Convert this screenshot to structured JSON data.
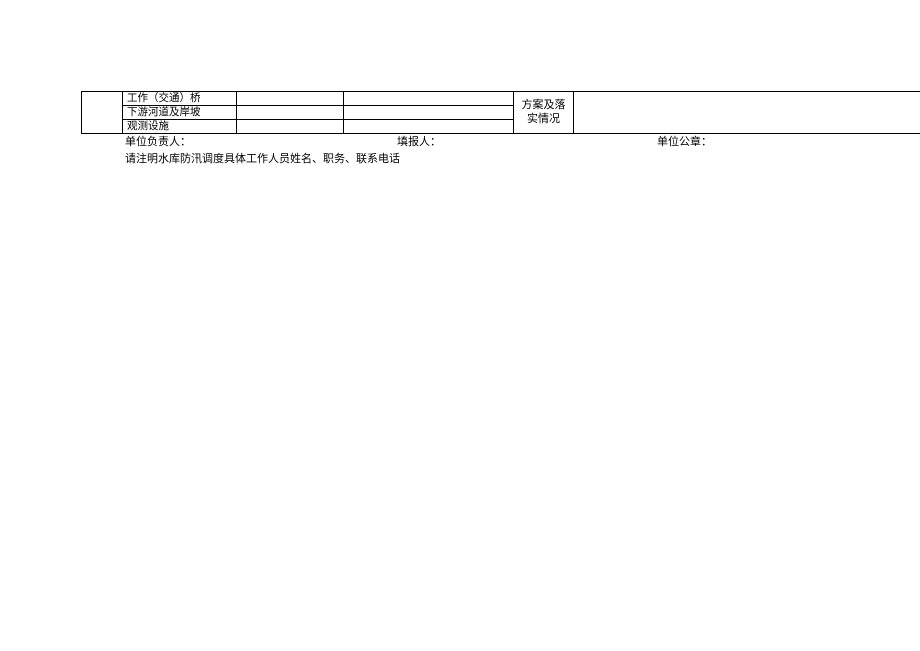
{
  "table": {
    "rows": [
      {
        "label": "工作（交通）桥"
      },
      {
        "label": "下游河道及岸坡"
      },
      {
        "label": "观测设施"
      }
    ],
    "right_header": "方案及落实情况"
  },
  "footer": {
    "responsible_label": "单位负责人：",
    "filler_label": "填报人：",
    "seal_label": "单位公章：",
    "note": "请注明水库防汛调度具体工作人员姓名、职务、联系电话"
  }
}
